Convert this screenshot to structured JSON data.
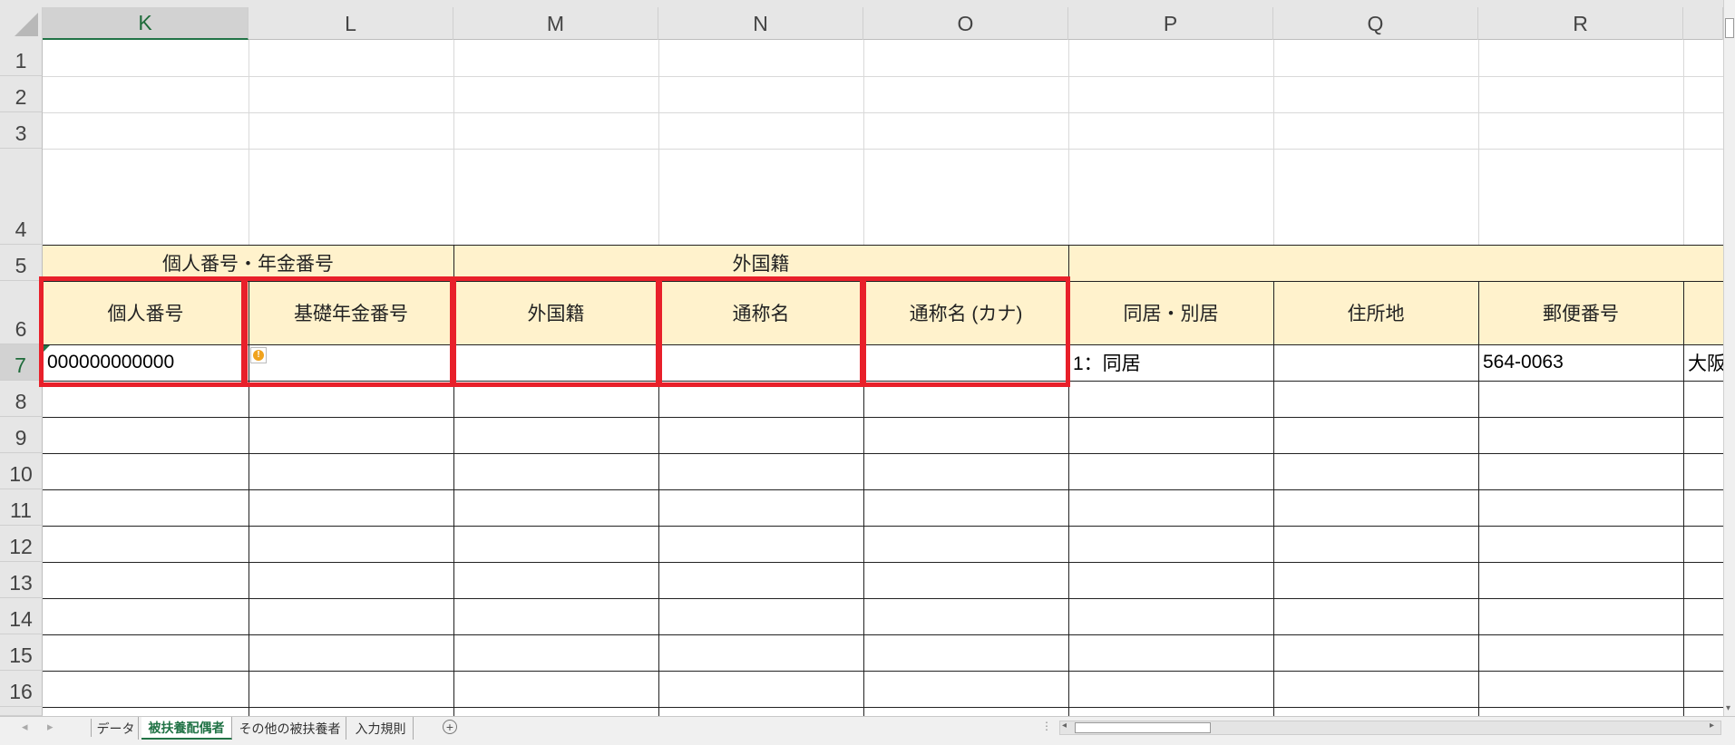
{
  "columns": [
    "K",
    "L",
    "M",
    "N",
    "O",
    "P",
    "Q",
    "R"
  ],
  "rows": [
    "1",
    "2",
    "3",
    "4",
    "5",
    "6",
    "7",
    "8",
    "9",
    "10",
    "11",
    "12",
    "13",
    "14",
    "15",
    "16"
  ],
  "row5": {
    "merged_kl": "個人番号・年金番号",
    "merged_mo": "外国籍"
  },
  "row6": [
    "個人番号",
    "基礎年金番号",
    "外国籍",
    "通称名",
    "通称名 (カナ)",
    "同居・別居",
    "住所地",
    "郵便番号"
  ],
  "row7": {
    "k": "000000000000",
    "p": "1：同居",
    "r": "564-0063",
    "s_partial": "大阪"
  },
  "warning_icon": "warning-icon",
  "sheet_tabs": [
    "データ",
    "被扶養配偶者",
    "その他の被扶養者",
    "入力規則"
  ],
  "active_sheet": "被扶養配偶者",
  "add_sheet_icon": "plus-circle-icon",
  "colors": {
    "header_fill": "#fff2cc",
    "highlight": "#e8202a",
    "excel_green": "#217346"
  }
}
